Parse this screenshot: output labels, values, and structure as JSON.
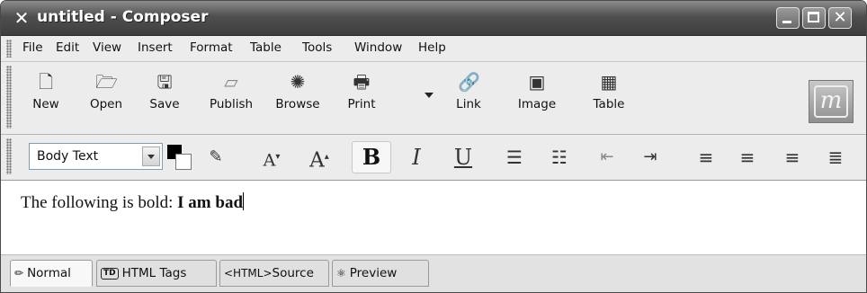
{
  "window": {
    "title": "untitled - Composer"
  },
  "menu": [
    "File",
    "Edit",
    "View",
    "Insert",
    "Format",
    "Table",
    "Tools",
    "Window",
    "Help"
  ],
  "toolbar": {
    "buttons": [
      "New",
      "Open",
      "Save",
      "Publish",
      "Browse",
      "Print",
      "Link",
      "Image",
      "Table"
    ]
  },
  "format": {
    "paragraph_style": "Body Text",
    "text_color": "#000000",
    "background_color": "#ffffff"
  },
  "editor": {
    "text_plain": "The following is bold: ",
    "text_bold": "I am bad"
  },
  "tabs": [
    "Normal",
    "HTML Tags",
    "Source",
    "Preview"
  ],
  "tab_labels": {
    "source_prefix": "<HTML>",
    "tags_icon_text": "TD"
  },
  "active_tab": "Normal"
}
